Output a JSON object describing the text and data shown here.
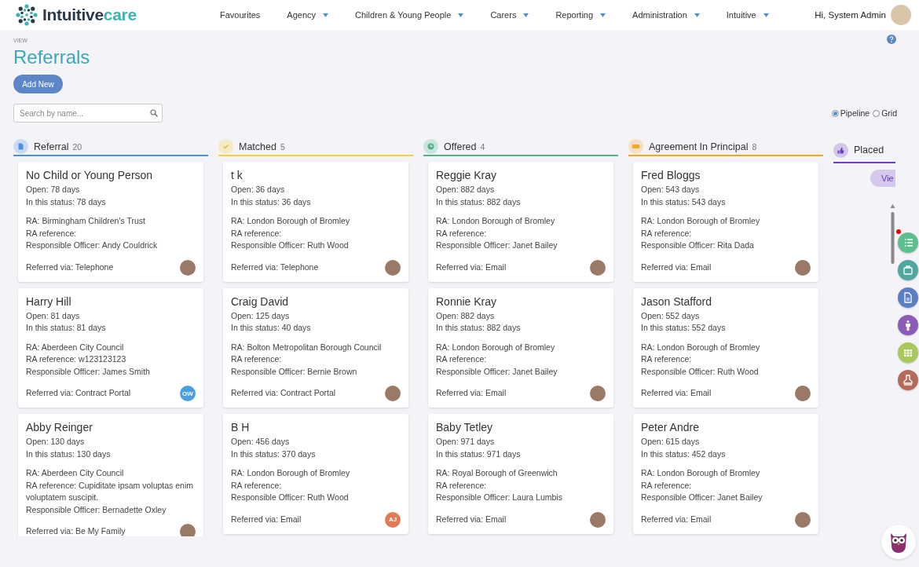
{
  "header": {
    "brand": "Intuitive",
    "brand_accent": "care",
    "nav": [
      {
        "label": "Favourites",
        "has_menu": false
      },
      {
        "label": "Agency",
        "has_menu": true
      },
      {
        "label": "Children & Young People",
        "has_menu": true
      },
      {
        "label": "Carers",
        "has_menu": true
      },
      {
        "label": "Reporting",
        "has_menu": true
      },
      {
        "label": "Administration",
        "has_menu": true
      },
      {
        "label": "Intuitive",
        "has_menu": true
      }
    ],
    "greeting": "Hi, System Admin"
  },
  "page": {
    "breadcrumb": "VIEW",
    "title": "Referrals",
    "add_button": "Add New",
    "search": {
      "placeholder": "Search by name..."
    },
    "views": [
      {
        "label": "Pipeline",
        "selected": true
      },
      {
        "label": "Grid",
        "selected": false
      }
    ]
  },
  "columns": [
    {
      "title": "Referral",
      "count": "20",
      "color": "#4a90e2",
      "cards": [
        {
          "name": "No Child or Young Person",
          "open": "Open: 78 days",
          "in_status": "In this status: 78 days",
          "ra": "RA: Birmingham Children's Trust",
          "ra_reference": "RA reference:",
          "officer": "Responsible Officer:  Andy Couldrick",
          "referred_via": "Referred via: Telephone",
          "avatar": {
            "kind": "photo"
          }
        },
        {
          "name": "Harry Hill",
          "open": "Open: 81 days",
          "in_status": "In this status: 81 days",
          "ra": "RA: Aberdeen City Council",
          "ra_reference": "RA reference: w123123123",
          "officer": "Responsible Officer: James Smith",
          "referred_via": "Referred via: Contract Portal",
          "avatar": {
            "kind": "initials",
            "text": "OW",
            "color": "#4a9fe0"
          }
        },
        {
          "name": "Abby Reinger",
          "open": "Open: 130 days",
          "in_status": "In this status: 130 days",
          "ra": "RA: Aberdeen City Council",
          "ra_reference": "RA reference: Cupiditate ipsam voluptas enim voluptatem suscipit.",
          "officer": "Responsible Officer: Bernadette Oxley",
          "referred_via": "Referred via: Be My Family",
          "avatar": {
            "kind": "photo"
          }
        }
      ]
    },
    {
      "title": "Matched",
      "count": "5",
      "color": "#f2d13c",
      "cards": [
        {
          "name": "t k",
          "open": "Open: 36 days",
          "in_status": "In this status: 36 days",
          "ra": "RA: London Borough of Bromley",
          "ra_reference": "RA reference:",
          "officer": "Responsible Officer: Ruth Wood",
          "referred_via": "Referred via: Telephone",
          "avatar": {
            "kind": "photo"
          }
        },
        {
          "name": "Craig David",
          "open": "Open: 125 days",
          "in_status": "In this status: 40 days",
          "ra": "RA: Bolton Metropolitan Borough Council",
          "ra_reference": "RA reference:",
          "officer": "Responsible Officer: Bernie Brown",
          "referred_via": "Referred via: Contract Portal",
          "avatar": {
            "kind": "photo"
          }
        },
        {
          "name": "B H",
          "open": "Open: 456 days",
          "in_status": "In this status: 370 days",
          "ra": "RA: London Borough of Bromley",
          "ra_reference": "RA reference:",
          "officer": "Responsible Officer: Ruth Wood",
          "referred_via": "Referred via: Email",
          "avatar": {
            "kind": "initials",
            "text": "AJ",
            "color": "#e07b55"
          }
        }
      ]
    },
    {
      "title": "Offered",
      "count": "4",
      "color": "#4cb88a",
      "cards": [
        {
          "name": "Reggie Kray",
          "open": "Open: 882 days",
          "in_status": "In this status: 882 days",
          "ra": "RA: London Borough of Bromley",
          "ra_reference": "RA reference:",
          "officer": "Responsible Officer: Janet Bailey",
          "referred_via": "Referred via: Email",
          "avatar": {
            "kind": "photo"
          }
        },
        {
          "name": "Ronnie Kray",
          "open": "Open: 882 days",
          "in_status": "In this status: 882 days",
          "ra": "RA: London Borough of Bromley",
          "ra_reference": "RA reference:",
          "officer": "Responsible Officer: Janet Bailey",
          "referred_via": "Referred via: Email",
          "avatar": {
            "kind": "photo"
          }
        },
        {
          "name": "Baby Tetley",
          "open": "Open: 971 days",
          "in_status": "In this status: 971 days",
          "ra": "RA: Royal Borough of Greenwich",
          "ra_reference": "RA reference:",
          "officer": "Responsible Officer: Laura Lumbis",
          "referred_via": "Referred via: Email",
          "avatar": {
            "kind": "photo"
          }
        }
      ]
    },
    {
      "title": "Agreement In Principal",
      "count": "8",
      "color": "#f5a623",
      "cards": [
        {
          "name": "Fred Bloggs",
          "open": "Open: 543 days",
          "in_status": "In this status: 543 days",
          "ra": "RA: London Borough of Bromley",
          "ra_reference": "RA reference:",
          "officer": "Responsible Officer: Rita Dada",
          "referred_via": "Referred via: Email",
          "avatar": {
            "kind": "photo"
          }
        },
        {
          "name": "Jason Stafford",
          "open": "Open: 552 days",
          "in_status": "In this status: 552 days",
          "ra": "RA: London Borough of Bromley",
          "ra_reference": "RA reference:",
          "officer": "Responsible Officer: Ruth Wood",
          "referred_via": "Referred via: Email",
          "avatar": {
            "kind": "photo"
          }
        },
        {
          "name": "Peter Andre",
          "open": "Open: 615 days",
          "in_status": "In this status: 452 days",
          "ra": "RA: London Borough of Bromley",
          "ra_reference": "RA reference:",
          "officer": "Responsible Officer: Janet Bailey",
          "referred_via": "Referred via: Email",
          "avatar": {
            "kind": "photo"
          }
        }
      ]
    },
    {
      "title": "Placed",
      "color": "#6a3fc1",
      "view_button": "Vie"
    }
  ],
  "side_actions": [
    {
      "notification": true
    },
    {
      "notification": false
    },
    {
      "notification": false
    },
    {
      "notification": false
    },
    {
      "notification": false
    },
    {
      "notification": false
    }
  ]
}
